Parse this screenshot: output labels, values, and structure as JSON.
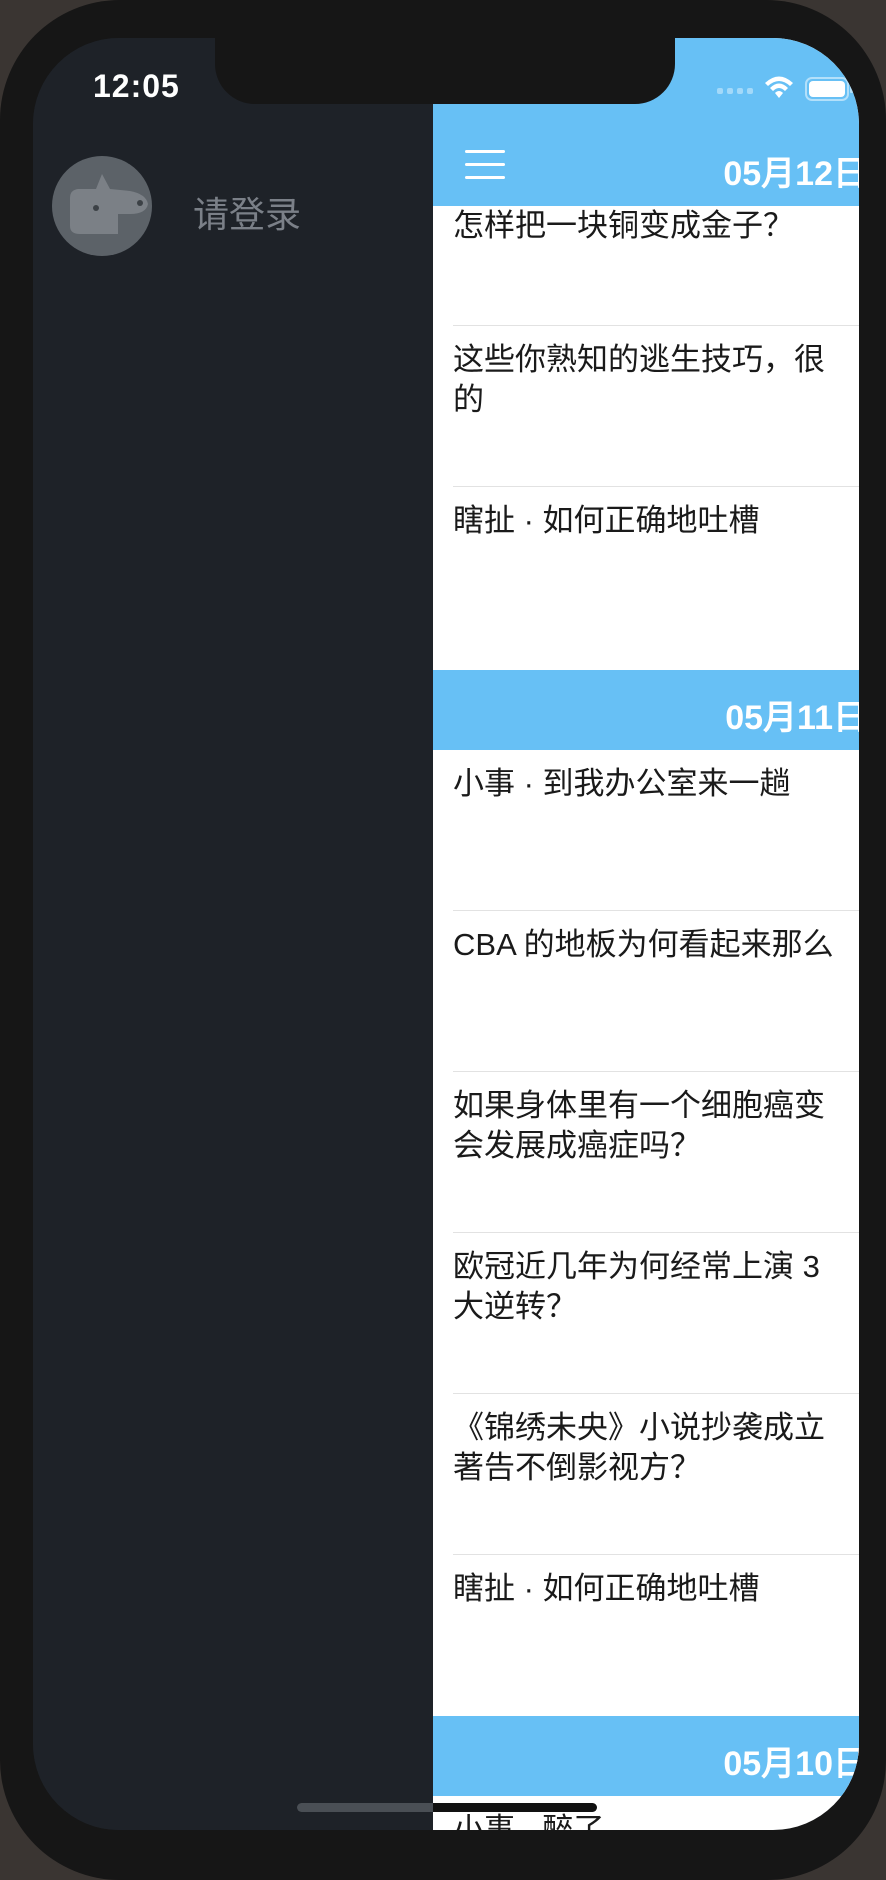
{
  "status_bar": {
    "time": "12:05"
  },
  "drawer": {
    "login_label": "请登录",
    "avatar_icon": "dog-avatar-icon"
  },
  "panel": {
    "menu_icon": "hamburger-menu-icon",
    "header_date": "05月12日",
    "articles_top": [
      {
        "title": "怎样把一块铜变成金子？"
      },
      {
        "title": "这些你熟知的逃生技巧，很",
        "title_line2": "的"
      },
      {
        "title": "瞎扯 · 如何正确地吐槽"
      }
    ],
    "section_1": {
      "date": "05月11日",
      "articles": [
        {
          "title": "小事 · 到我办公室来一趟"
        },
        {
          "title": "CBA 的地板为何看起来那么"
        },
        {
          "title": "如果身体里有一个细胞癌变",
          "title_line2": "会发展成癌症吗？"
        },
        {
          "title": "欧冠近几年为何经常上演 3",
          "title_line2": "大逆转？"
        },
        {
          "title": "《锦绣未央》小说抄袭成立",
          "title_line2": "著告不倒影视方？"
        },
        {
          "title": "瞎扯 · 如何正确地吐槽"
        }
      ]
    },
    "section_2": {
      "date": "05月10日",
      "articles": [
        {
          "title": "小事 · 醉了"
        }
      ]
    }
  },
  "colors": {
    "accent": "#67c0f5",
    "drawer_bg": "#1e2228",
    "device_bezel": "#161616"
  }
}
